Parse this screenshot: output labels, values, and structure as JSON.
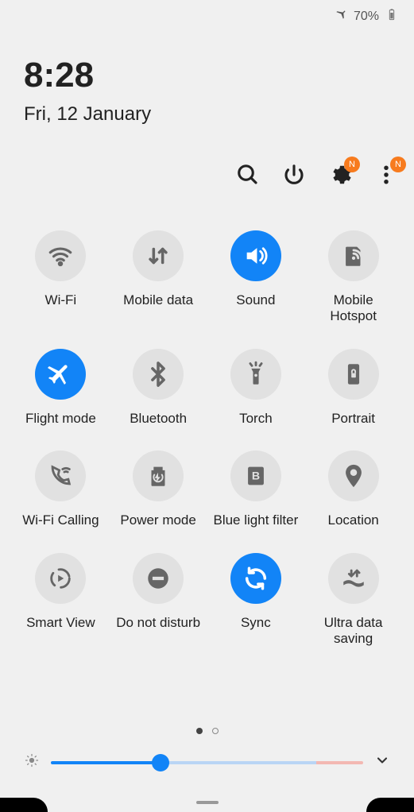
{
  "status": {
    "battery": "70%"
  },
  "clock": "8:28",
  "date": "Fri, 12 January",
  "toolbar": {
    "badge": "N"
  },
  "tiles": {
    "wifi": "Wi-Fi",
    "mobile_data": "Mobile data",
    "sound": "Sound",
    "hotspot": "Mobile Hotspot",
    "flight": "Flight mode",
    "bluetooth": "Bluetooth",
    "torch": "Torch",
    "portrait": "Portrait",
    "wifi_calling": "Wi-Fi Calling",
    "power_mode": "Power mode",
    "blue_light": "Blue light filter",
    "location": "Location",
    "smart_view": "Smart View",
    "dnd": "Do not disturb",
    "sync": "Sync",
    "ultra_data": "Ultra data saving"
  }
}
